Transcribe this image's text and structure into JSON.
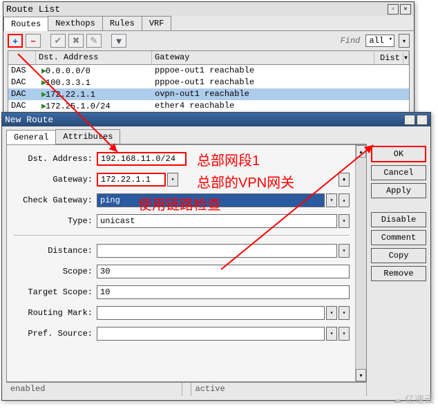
{
  "route_list": {
    "title": "Route List",
    "tabs": [
      "Routes",
      "Nexthops",
      "Rules",
      "VRF"
    ],
    "active_tab": 0,
    "find_label": "Find",
    "filter_value": "all",
    "columns": {
      "dst": "Dst. Address",
      "gw": "Gateway",
      "dist": "Dist"
    },
    "rows": [
      {
        "flags": "DAS",
        "dst": "0.0.0.0/0",
        "gw": "pppoe-out1 reachable",
        "selected": false
      },
      {
        "flags": "DAC",
        "dst": "100.3.3.1",
        "gw": "pppoe-out1 reachable",
        "selected": false
      },
      {
        "flags": "DAC",
        "dst": "172.22.1.1",
        "gw": "ovpn-out1 reachable",
        "selected": true
      },
      {
        "flags": "DAC",
        "dst": "172.25.1.0/24",
        "gw": "ether4 reachable",
        "selected": false
      }
    ]
  },
  "new_route": {
    "title": "New Route",
    "tabs": [
      "General",
      "Attributes"
    ],
    "active_tab": 0,
    "fields": {
      "dst_address": {
        "label": "Dst. Address:",
        "value": "192.168.11.0/24"
      },
      "gateway": {
        "label": "Gateway:",
        "value": "172.22.1.1"
      },
      "check_gateway": {
        "label": "Check Gateway:",
        "value": "ping"
      },
      "type": {
        "label": "Type:",
        "value": "unicast"
      },
      "distance": {
        "label": "Distance:",
        "value": ""
      },
      "scope": {
        "label": "Scope:",
        "value": "30"
      },
      "target_scope": {
        "label": "Target Scope:",
        "value": "10"
      },
      "routing_mark": {
        "label": "Routing Mark:",
        "value": ""
      },
      "pref_source": {
        "label": "Pref. Source:",
        "value": ""
      }
    },
    "buttons": {
      "ok": "OK",
      "cancel": "Cancel",
      "apply": "Apply",
      "disable": "Disable",
      "comment": "Comment",
      "copy": "Copy",
      "remove": "Remove"
    },
    "status": {
      "left": "enabled",
      "right": "active"
    }
  },
  "annotations": {
    "a1": "总部网段1",
    "a2": "总部的VPN网关",
    "a3": "使用链路检查"
  },
  "watermark": "亿速云"
}
